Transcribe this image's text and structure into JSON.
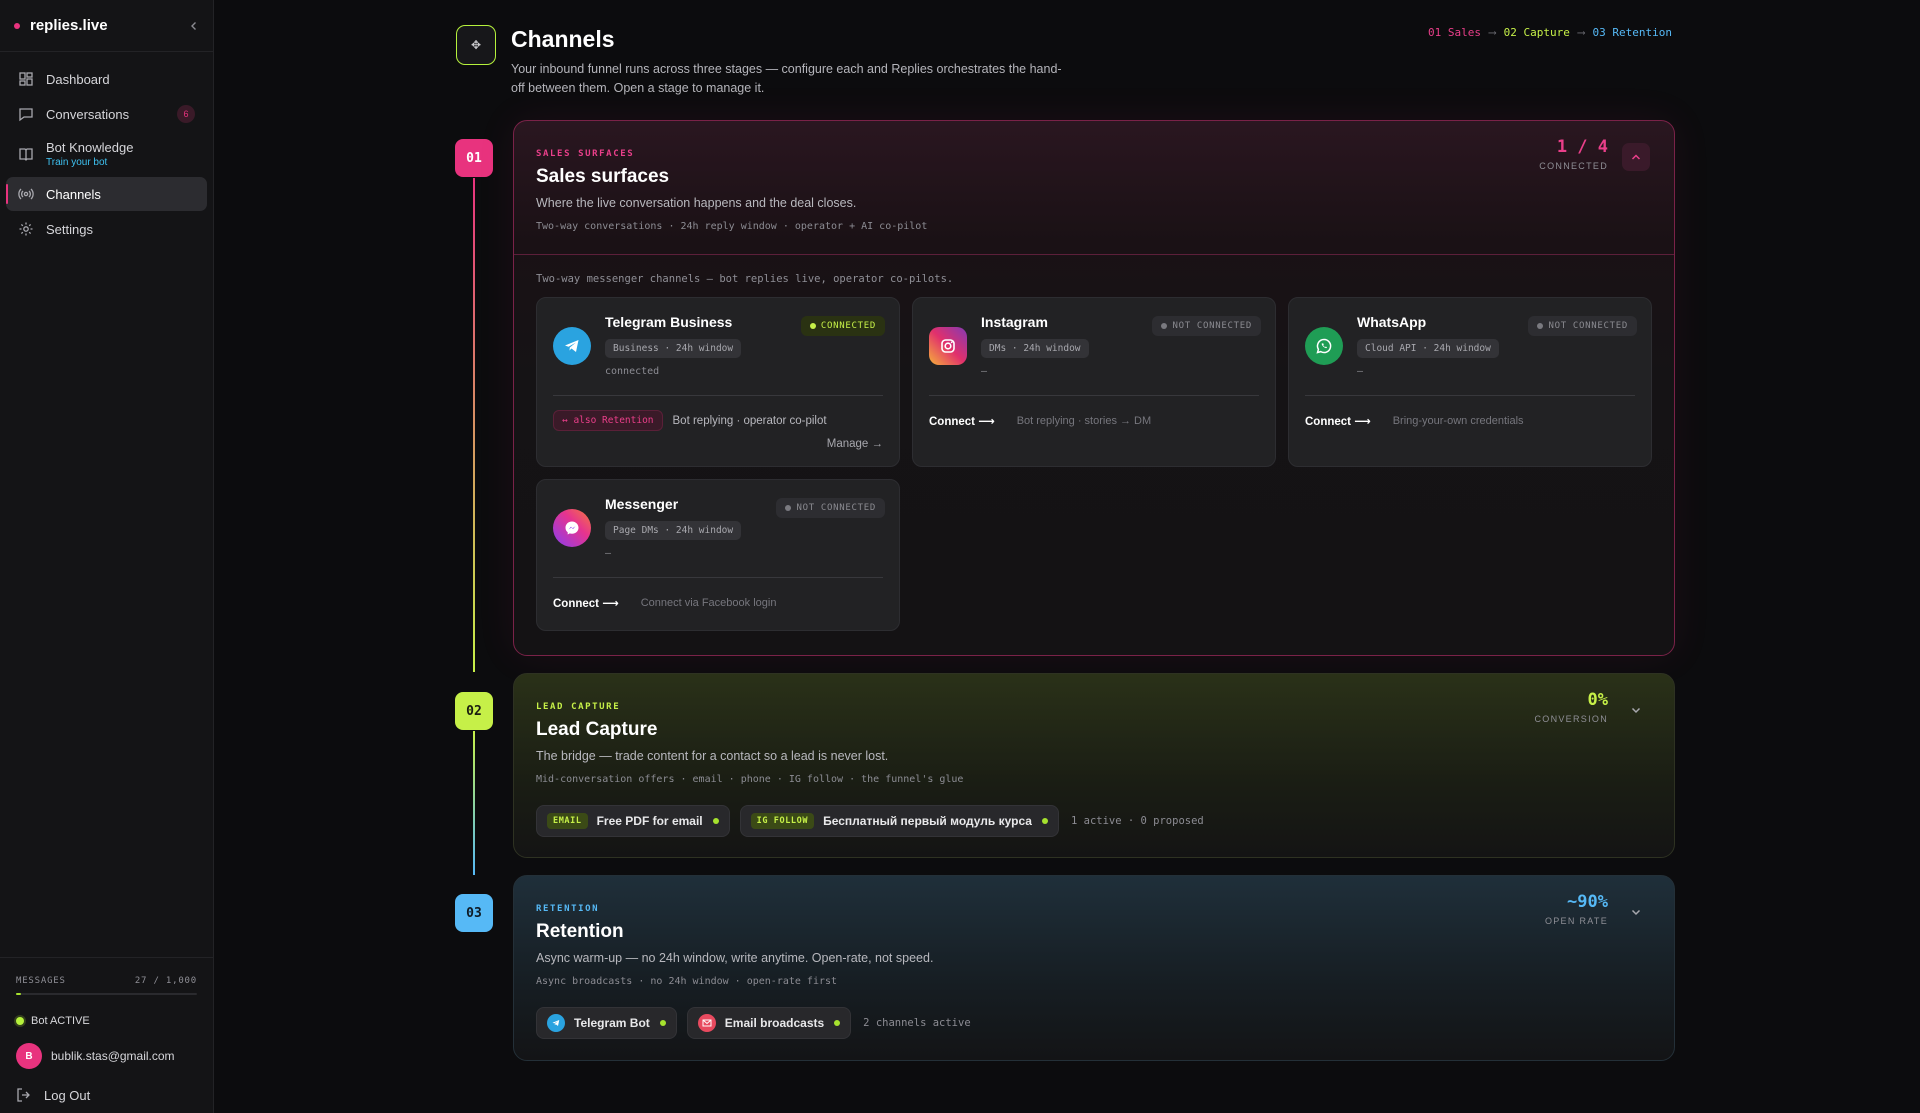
{
  "app": {
    "name": "replies.live"
  },
  "sidebar": {
    "items": [
      {
        "label": "Dashboard"
      },
      {
        "label": "Conversations",
        "badge": "6"
      },
      {
        "label": "Bot Knowledge",
        "sub": "Train your bot"
      },
      {
        "label": "Channels"
      },
      {
        "label": "Settings"
      }
    ],
    "messages": {
      "label": "MESSAGES",
      "count": "27 / 1,000",
      "used_fraction": 0.027
    },
    "bot_status": "Bot ACTIVE",
    "user_email": "bublik.stas@gmail.com",
    "user_initial": "B",
    "logout": "Log Out"
  },
  "page": {
    "title": "Channels",
    "description": "Your inbound funnel runs across three stages — configure each and Replies orchestrates the hand-off between them. Open a stage to manage it.",
    "crumbs": [
      "01 Sales",
      "02 Capture",
      "03 Retention"
    ],
    "crumb_arrow": "⟶"
  },
  "stages": {
    "sales": {
      "num": "01",
      "eyebrow": "SALES SURFACES",
      "title": "Sales surfaces",
      "subtitle": "Where the live conversation happens and the deal closes.",
      "meta": "Two-way conversations · 24h reply window · operator + AI co-pilot",
      "metric_value": "1 / 4",
      "metric_label": "CONNECTED",
      "body_note": "Two-way messenger channels — bot replies live, operator co-pilots.",
      "channels": [
        {
          "name": "Telegram Business",
          "tag": "Business · 24h window",
          "sub": "connected",
          "status": "CONNECTED",
          "also": "↔ also Retention",
          "foot": "Bot replying · operator co-pilot",
          "manage": "Manage →"
        },
        {
          "name": "Instagram",
          "tag": "DMs · 24h window",
          "sub": "—",
          "status": "NOT CONNECTED",
          "connect": "Connect ⟶",
          "foot": "Bot replying · stories → DM"
        },
        {
          "name": "WhatsApp",
          "tag": "Cloud API · 24h window",
          "sub": "—",
          "status": "NOT CONNECTED",
          "connect": "Connect ⟶",
          "foot": "Bring-your-own credentials"
        },
        {
          "name": "Messenger",
          "tag": "Page DMs · 24h window",
          "sub": "—",
          "status": "NOT CONNECTED",
          "connect": "Connect ⟶",
          "foot": "Connect via Facebook login"
        }
      ]
    },
    "capture": {
      "num": "02",
      "eyebrow": "LEAD CAPTURE",
      "title": "Lead Capture",
      "subtitle": "The bridge — trade content for a contact so a lead is never lost.",
      "meta": "Mid-conversation offers · email · phone · IG follow · the funnel's glue",
      "metric_value": "0%",
      "metric_label": "CONVERSION",
      "chips": [
        {
          "tag": "EMAIL",
          "label": "Free PDF for email"
        },
        {
          "tag": "IG FOLLOW",
          "label": "Бесплатный первый модуль курса"
        }
      ],
      "note": "1 active · 0 proposed"
    },
    "retention": {
      "num": "03",
      "eyebrow": "RETENTION",
      "title": "Retention",
      "subtitle": "Async warm-up — no 24h window, write anytime. Open-rate, not speed.",
      "meta": "Async broadcasts · no 24h window · open-rate first",
      "metric_value": "~90%",
      "metric_label": "OPEN RATE",
      "chips": [
        {
          "label": "Telegram Bot"
        },
        {
          "label": "Email broadcasts"
        }
      ],
      "note": "2 channels active"
    }
  },
  "colors": {
    "pink": "#ea3f8a",
    "lime": "#c6f048",
    "blue": "#56b9f6"
  }
}
